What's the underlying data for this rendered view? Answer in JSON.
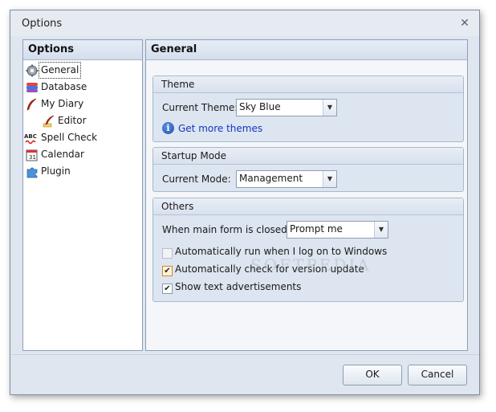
{
  "window": {
    "title": "Options"
  },
  "sidebar": {
    "title": "Options",
    "items": [
      {
        "label": "General",
        "icon": "gear-icon",
        "selected": true,
        "indent": 0
      },
      {
        "label": "Database",
        "icon": "database-icon",
        "indent": 0
      },
      {
        "label": "My Diary",
        "icon": "diary-quill-icon",
        "indent": 0
      },
      {
        "label": "Editor",
        "icon": "editor-quill-icon",
        "indent": 1
      },
      {
        "label": "Spell Check",
        "icon": "spell-check-icon",
        "indent": 0
      },
      {
        "label": "Calendar",
        "icon": "calendar-icon",
        "indent": 0
      },
      {
        "label": "Plugin",
        "icon": "plugin-icon",
        "indent": 0
      }
    ]
  },
  "main": {
    "title": "General",
    "theme": {
      "title": "Theme",
      "label": "Current Theme:",
      "value": "Sky Blue",
      "link": "Get more themes"
    },
    "startup": {
      "title": "Startup Mode",
      "label": "Current Mode:",
      "value": "Management"
    },
    "others": {
      "title": "Others",
      "close_label": "When main form is closed:",
      "close_value": "Prompt me",
      "checkboxes": [
        {
          "label": "Automatically run when I log on to Windows",
          "checked": false
        },
        {
          "label": "Automatically check for version update",
          "checked": true
        },
        {
          "label": "Show text advertisements",
          "checked": true
        }
      ]
    }
  },
  "footer": {
    "ok": "OK",
    "cancel": "Cancel"
  },
  "watermark": "SOFTPEDIA"
}
